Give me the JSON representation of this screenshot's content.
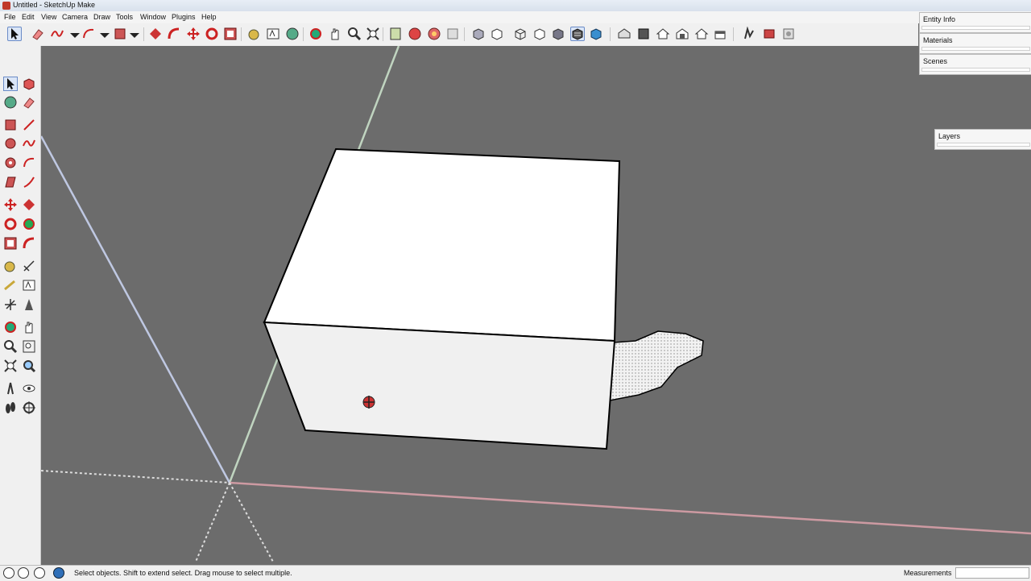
{
  "window": {
    "title": "Untitled - SketchUp Make"
  },
  "menu": [
    "File",
    "Edit",
    "View",
    "Camera",
    "Draw",
    "Tools",
    "Window",
    "Plugins",
    "Help"
  ],
  "trays": {
    "entity_info": "Entity Info",
    "materials": "Materials",
    "scenes": "Scenes",
    "layers": "Layers"
  },
  "status": {
    "hint": "Select objects. Shift to extend select. Drag mouse to select multiple.",
    "measurements_label": "Measurements",
    "measurements_value": ""
  },
  "colors": {
    "viewport_bg": "#6c6c6c",
    "face_top": "#ffffff",
    "face_front": "#f0f0f0",
    "edge": "#000000",
    "axis_red": "#d8a0a8",
    "axis_green": "#cfe7cf",
    "axis_blue": "#c9d2ef"
  },
  "icons": {
    "toolbar": [
      "select-icon",
      "eraser-icon",
      "freehand-icon",
      "arc-icon",
      "rectangle-icon",
      "move-icon",
      "rotate-icon",
      "pan-orbit-icon",
      "refresh-icon",
      "scale-icon",
      "tape-measure-icon",
      "text-icon",
      "paint-bucket-icon",
      "orbit-icon",
      "pan-icon",
      "zoom-icon",
      "zoom-extents-icon",
      "previous-view-icon",
      "section-icon",
      "section-display-icon",
      "x-ray-icon",
      "wireframe-icon",
      "hidden-line-icon",
      "shaded-icon",
      "shaded-textures-icon",
      "monochrome-icon",
      "iso-view-icon",
      "top-view-icon",
      "front-view-icon",
      "right-view-icon",
      "back-view-icon",
      "left-view-icon",
      "add-location-icon",
      "toggle-terrain-icon",
      "photo-texture-icon"
    ],
    "left": [
      "select-icon",
      "make-component-icon",
      "paint-bucket-icon",
      "eraser-icon",
      "rectangle-icon",
      "line-icon",
      "circle-icon",
      "arc-icon",
      "polygon-icon",
      "freehand-icon",
      "move-icon",
      "push-pull-icon",
      "rotate-icon",
      "follow-me-icon",
      "scale-icon",
      "offset-icon",
      "tape-measure-icon",
      "dimension-icon",
      "protractor-icon",
      "text-icon",
      "axes-icon",
      "3d-text-icon",
      "orbit-icon",
      "pan-icon",
      "zoom-icon",
      "zoom-window-icon",
      "zoom-extents-icon",
      "previous-view-icon",
      "position-camera-icon",
      "look-around-icon",
      "walk-icon",
      "section-plane-icon"
    ]
  }
}
